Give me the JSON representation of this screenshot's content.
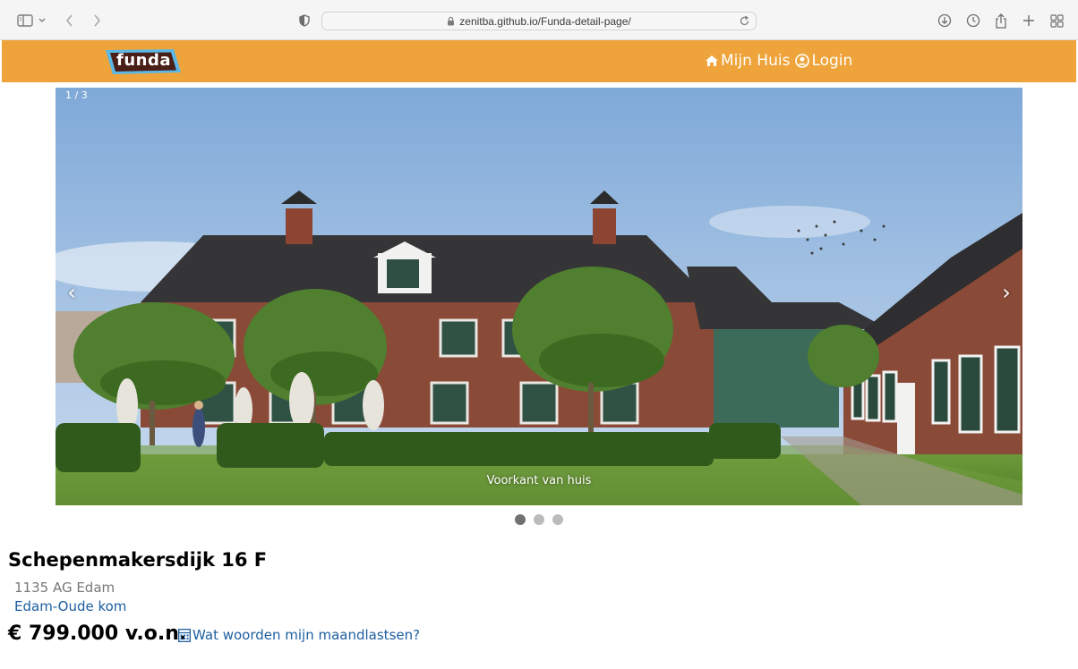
{
  "browser": {
    "url": "zenitba.github.io/Funda-detail-page/"
  },
  "header": {
    "logo_text": "funda",
    "nav": [
      {
        "label": "Mijn Huis",
        "icon": "home-icon"
      },
      {
        "label": "Login",
        "icon": "user-circle-icon"
      }
    ],
    "colors": {
      "bar": "#eea43a",
      "logo_bg": "#4a1f18",
      "logo_border": "#5bb8e6"
    }
  },
  "carousel": {
    "counter": "1 / 3",
    "caption": "Voorkant van huis",
    "prev_label": "‹",
    "next_label": "›",
    "slide_count": 3,
    "active_slide": 1
  },
  "listing": {
    "street": "Schepenmakersdijk 16 F",
    "postcode_city": "1135 AG Edam",
    "neighbourhood": "Edam-Oude kom",
    "price": "€ 799.000 v.o.n.",
    "mortgage_link": "Wat woorden mijn maandlastsen?",
    "link_color": "#1d5fa0"
  }
}
